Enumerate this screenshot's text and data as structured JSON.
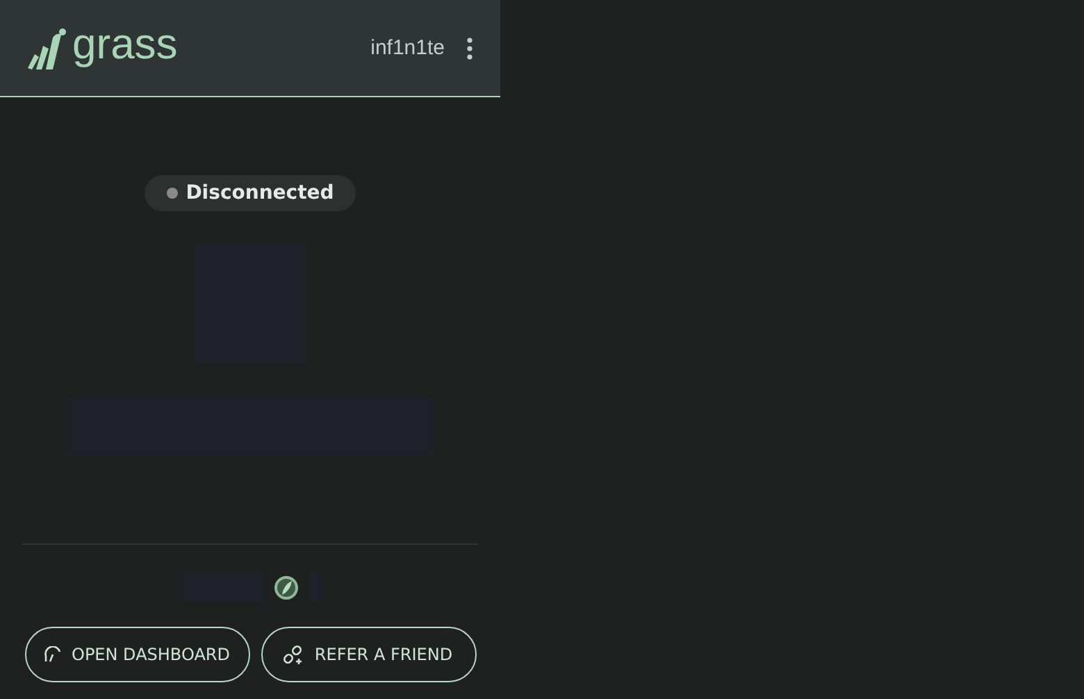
{
  "header": {
    "logo": "grass",
    "username": "inf1n1te"
  },
  "status": {
    "label": "Disconnected",
    "connected": false
  },
  "buttons": [
    {
      "label": "OPEN DASHBOARD",
      "kind": "dashboard"
    },
    {
      "label": "REFER A FRIEND",
      "kind": "refer"
    }
  ]
}
